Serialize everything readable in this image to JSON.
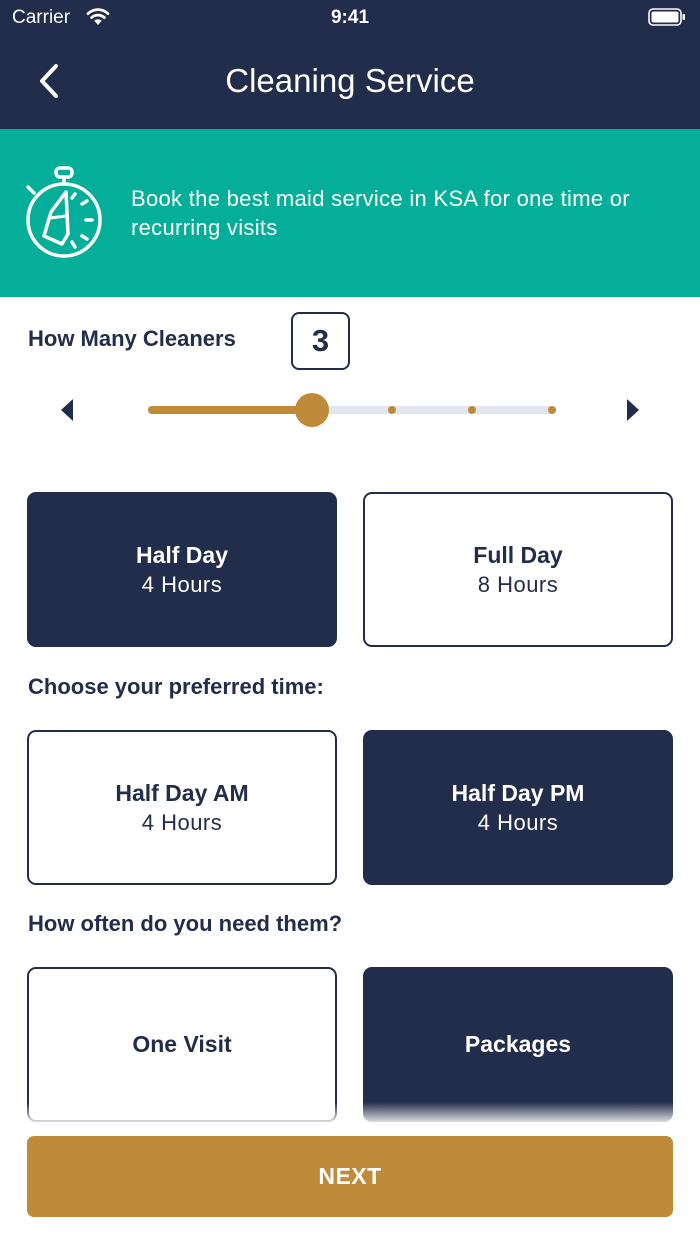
{
  "status_bar": {
    "carrier": "Carrier",
    "time": "9:41"
  },
  "header": {
    "title": "Cleaning Service"
  },
  "banner": {
    "text": "Book the best maid service in KSA for one time or recurring visits",
    "icon": "stopwatch-cleaning-icon"
  },
  "cleaners": {
    "label": "How Many Cleaners",
    "value": "3",
    "slider": {
      "min": 1,
      "max": 6,
      "value": 3
    }
  },
  "duration": {
    "options": [
      {
        "main": "Half Day",
        "sub": "4 Hours",
        "selected": true
      },
      {
        "main": "Full Day",
        "sub": "8 Hours",
        "selected": false
      }
    ]
  },
  "time": {
    "label": "Choose your preferred time:",
    "options": [
      {
        "main": "Half Day AM",
        "sub": "4 Hours",
        "selected": false
      },
      {
        "main": "Half Day PM",
        "sub": "4 Hours",
        "selected": true
      }
    ]
  },
  "frequency": {
    "label": "How often do you need them?",
    "options": [
      {
        "main": "One Visit",
        "selected": false
      },
      {
        "main": "Packages",
        "selected": true
      }
    ]
  },
  "next_button": "NEXT",
  "colors": {
    "navy": "#222d4b",
    "teal": "#04ae98",
    "gold": "#c08a3b",
    "track": "#e2e6ea"
  }
}
